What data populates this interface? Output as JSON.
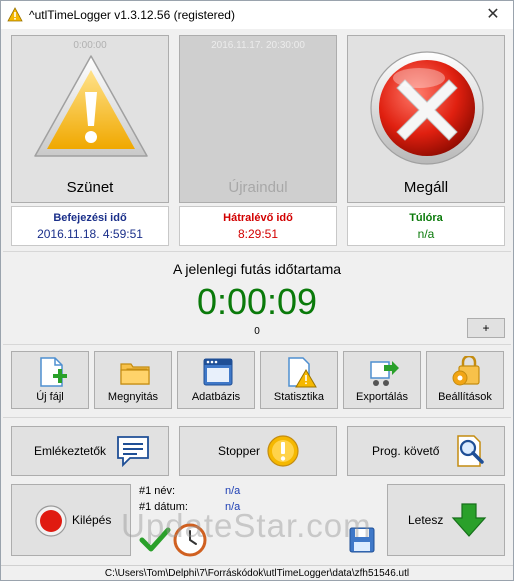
{
  "window": {
    "title": "^utlTimeLogger v1.3.12.56 (registered)",
    "close_glyph": "✕"
  },
  "top_buttons": {
    "pause": {
      "label": "Szünet",
      "time_caption": "0:00:00",
      "icon": "warning-triangle-icon"
    },
    "restart": {
      "label": "Újraindul",
      "time_caption": "2016.11.17. 20:30:00"
    },
    "stop": {
      "label": "Megáll",
      "icon": "red-x-stop-icon"
    }
  },
  "info": {
    "end_time": {
      "heading": "Befejezési idő",
      "value": "2016.11.18. 4:59:51",
      "color": "#1a2f8a"
    },
    "remaining": {
      "heading": "Hátralévő idő",
      "value": "8:29:51",
      "color": "#d20000"
    },
    "overtime": {
      "heading": "Túlóra",
      "value": "n/a",
      "color": "#0a7a0a"
    }
  },
  "run": {
    "label": "A jelenlegi futás időtartama",
    "duration": "0:00:09",
    "counter": "0",
    "plus_label": "+"
  },
  "toolbar": [
    {
      "label": "Új fájl",
      "icon": "new-file-icon"
    },
    {
      "label": "Megnyitás",
      "icon": "open-folder-icon"
    },
    {
      "label": "Adatbázis",
      "icon": "database-window-icon"
    },
    {
      "label": "Statisztika",
      "icon": "statistics-warning-icon"
    },
    {
      "label": "Exportálás",
      "icon": "export-cart-icon"
    },
    {
      "label": "Beállítások",
      "icon": "settings-lock-icon"
    }
  ],
  "middle_buttons": {
    "reminders": {
      "label": "Emlékeztetők",
      "icon": "message-icon"
    },
    "stopper": {
      "label": "Stopper",
      "icon": "exclamation-circle-icon"
    },
    "prog_tracker": {
      "label": "Prog. követő",
      "icon": "magnifier-document-icon"
    }
  },
  "bottom": {
    "exit_label": "Kilépés",
    "name_label": "#1 név:",
    "name_value": "n/a",
    "date_label": "#1 dátum:",
    "date_value": "n/a",
    "putdown_label": "Letesz"
  },
  "watermark": "UpdateStar.com",
  "statusbar": {
    "path": "C:\\Users\\Tom\\Delphi\\7\\Forráskódok\\utlTimeLogger\\data\\zfh51546.utl"
  }
}
